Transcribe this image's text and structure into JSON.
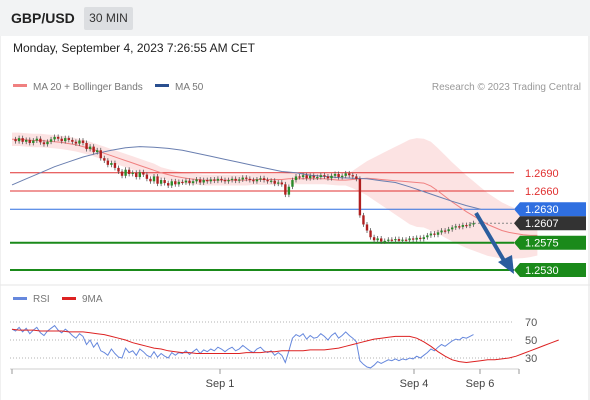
{
  "header": {
    "pair": "GBP/USD",
    "timeframe": "30 MIN"
  },
  "timestamp": "Monday, September 4, 2023 7:26:55 AM CET",
  "legend": {
    "ma20_bb": "MA 20 + Bollinger Bands",
    "ma50": "MA 50",
    "copyright": "Research © 2023 Trading Central"
  },
  "rsi_legend": {
    "rsi": "RSI",
    "ma9": "9MA"
  },
  "colors": {
    "bb": "#f08080",
    "ma50": "#2a4f8f",
    "resistance": "#e03030",
    "support": "#1a8a1a",
    "pivot": "#2f6fe0",
    "price": "#333333",
    "arrow": "#2b5d9e",
    "rsi": "#6688dd",
    "rsi_ma": "#dd2222"
  },
  "chart_data": {
    "type": "line",
    "title": "GBP/USD",
    "ylim": [
      1.2512,
      1.2785
    ],
    "price_levels": [
      {
        "label": "1.2690",
        "value": 1.269,
        "kind": "resistance"
      },
      {
        "label": "1.2660",
        "value": 1.266,
        "kind": "resistance"
      },
      {
        "label": "1.2630",
        "value": 1.263,
        "kind": "pivot"
      },
      {
        "label": "1.2607",
        "value": 1.2607,
        "kind": "last"
      },
      {
        "label": "1.2575",
        "value": 1.2575,
        "kind": "support"
      },
      {
        "label": "1.2530",
        "value": 1.253,
        "kind": "support"
      }
    ],
    "x_ticks": [
      "Sep 1",
      "Sep 4",
      "Sep 6"
    ],
    "close": [
      1.2745,
      1.2742,
      1.2747,
      1.2741,
      1.2744,
      1.2739,
      1.2743,
      1.2746,
      1.274,
      1.2737,
      1.2741,
      1.2745,
      1.2749,
      1.2746,
      1.2742,
      1.2747,
      1.2744,
      1.2741,
      1.2738,
      1.2743,
      1.2739,
      1.2729,
      1.2733,
      1.2724,
      1.2727,
      1.2714,
      1.271,
      1.2703,
      1.2706,
      1.2698,
      1.2692,
      1.2685,
      1.2695,
      1.2688,
      1.269,
      1.2683,
      1.2691,
      1.2687,
      1.268,
      1.2676,
      1.2684,
      1.2672,
      1.2678,
      1.2673,
      1.2669,
      1.2676,
      1.2671,
      1.2675,
      1.2674,
      1.2677,
      1.2673,
      1.2676,
      1.2679,
      1.2674,
      1.2678,
      1.2676,
      1.2679,
      1.2677,
      1.268,
      1.2678,
      1.2676,
      1.2678,
      1.268,
      1.2677,
      1.2679,
      1.2682,
      1.268,
      1.2678,
      1.2676,
      1.2679,
      1.2681,
      1.2678,
      1.2676,
      1.2677,
      1.2672,
      1.2674,
      1.2671,
      1.2654,
      1.2667,
      1.2678,
      1.2684,
      1.2683,
      1.2686,
      1.2681,
      1.2685,
      1.2682,
      1.2683,
      1.2686,
      1.2684,
      1.2681,
      1.2685,
      1.2688,
      1.2683,
      1.2685,
      1.2689,
      1.2686,
      1.2684,
      1.268,
      1.262,
      1.2605,
      1.2595,
      1.2584,
      1.2579,
      1.2582,
      1.2577,
      1.2578,
      1.258,
      1.2579,
      1.2581,
      1.2578,
      1.258,
      1.2579,
      1.2582,
      1.258,
      1.2583,
      1.2581,
      1.2584,
      1.2587,
      1.259,
      1.2588,
      1.2592,
      1.2595,
      1.2594,
      1.2597,
      1.26,
      1.2602,
      1.2601,
      1.2604,
      1.2603,
      1.2605,
      1.2607
    ],
    "ma20": [
      1.2745,
      1.2745,
      1.2744,
      1.2743,
      1.2743,
      1.2742,
      1.2741,
      1.274,
      1.2738,
      1.2736,
      1.2733,
      1.273,
      1.2726,
      1.2722,
      1.2718,
      1.2714,
      1.271,
      1.2706,
      1.2702,
      1.2698,
      1.2694,
      1.269,
      1.2687,
      1.2684,
      1.2682,
      1.268,
      1.2679,
      1.2678,
      1.2678,
      1.2678,
      1.2678,
      1.2678,
      1.2678,
      1.2678,
      1.2679,
      1.2679,
      1.2679,
      1.2679,
      1.2679,
      1.268,
      1.268,
      1.268,
      1.268,
      1.268,
      1.268,
      1.2679,
      1.2678,
      1.2678,
      1.2679,
      1.268,
      1.2681,
      1.268,
      1.2679,
      1.2678,
      1.2677,
      1.2676,
      1.2675,
      1.2674,
      1.2673,
      1.2668,
      1.266,
      1.2651,
      1.2642,
      1.2634,
      1.2626,
      1.2619,
      1.2612,
      1.2605,
      1.26,
      1.2595,
      1.2592,
      1.259,
      1.2588,
      1.2587,
      1.2587
    ],
    "ma20_x": [
      0,
      2,
      4,
      6,
      8,
      10,
      12,
      14,
      16,
      18,
      20,
      22,
      24,
      26,
      28,
      30,
      32,
      34,
      36,
      38,
      40,
      42,
      44,
      46,
      48,
      50,
      52,
      54,
      56,
      58,
      60,
      62,
      64,
      66,
      68,
      70,
      72,
      74,
      76,
      78,
      80,
      82,
      84,
      86,
      88,
      90,
      92,
      94,
      96,
      98,
      100,
      102,
      104,
      106,
      108,
      110,
      112,
      114,
      116,
      118,
      120,
      122,
      124,
      126,
      128,
      130,
      132,
      134,
      136,
      138,
      140,
      142,
      144,
      146,
      148
    ],
    "ma50": [
      1.267,
      1.268,
      1.269,
      1.27,
      1.2708,
      1.2716,
      1.2722,
      1.2727,
      1.2731,
      1.2733,
      1.2732,
      1.273,
      1.2727,
      1.2722,
      1.2717,
      1.2712,
      1.2707,
      1.2702,
      1.2697,
      1.2692,
      1.269,
      1.2686,
      1.2684,
      1.2682,
      1.2681,
      1.268,
      1.2677,
      1.2674,
      1.2667,
      1.2659,
      1.2651,
      1.2643,
      1.2636,
      1.263
    ],
    "ma50_x": [
      0,
      4,
      8,
      12,
      16,
      20,
      24,
      28,
      32,
      36,
      40,
      44,
      48,
      52,
      56,
      60,
      64,
      68,
      72,
      76,
      80,
      84,
      88,
      92,
      96,
      100,
      104,
      108,
      112,
      116,
      120,
      124,
      128,
      132
    ],
    "rsi_ylim": [
      20,
      80
    ],
    "rsi_ticks": [
      70,
      50,
      30
    ],
    "rsi": [
      62,
      60,
      64,
      59,
      63,
      57,
      61,
      64,
      58,
      55,
      60,
      63,
      66,
      61,
      58,
      62,
      59,
      55,
      52,
      57,
      54,
      45,
      50,
      42,
      47,
      38,
      36,
      33,
      40,
      35,
      31,
      30,
      41,
      36,
      38,
      33,
      40,
      37,
      33,
      31,
      37,
      31,
      35,
      32,
      30,
      36,
      33,
      36,
      35,
      38,
      34,
      37,
      40,
      35,
      39,
      37,
      40,
      38,
      42,
      40,
      37,
      40,
      42,
      38,
      40,
      44,
      41,
      38,
      36,
      40,
      42,
      38,
      36,
      38,
      33,
      36,
      33,
      25,
      38,
      52,
      56,
      54,
      57,
      51,
      55,
      52,
      53,
      57,
      54,
      50,
      55,
      58,
      52,
      55,
      59,
      55,
      52,
      48,
      27,
      23,
      20,
      19,
      22,
      26,
      24,
      26,
      28,
      27,
      29,
      27,
      29,
      28,
      30,
      29,
      32,
      30,
      33,
      36,
      40,
      38,
      42,
      45,
      43,
      46,
      49,
      51,
      50,
      53,
      52,
      54,
      56
    ],
    "rsi_ma": [
      62,
      61,
      61,
      61,
      60,
      60,
      60,
      60,
      59,
      59,
      59,
      58,
      57,
      56,
      54,
      52,
      50,
      47,
      45,
      43,
      41,
      40,
      38,
      37,
      36,
      36,
      35,
      35,
      35,
      35,
      35,
      35,
      35,
      36,
      36,
      36,
      37,
      37,
      38,
      38,
      38,
      38,
      39,
      39,
      39,
      40,
      41,
      43,
      45,
      47,
      49,
      51,
      52,
      53,
      54,
      54,
      54,
      52,
      48,
      43,
      37,
      32,
      28,
      26,
      25,
      26,
      27,
      28,
      28,
      29,
      30,
      32,
      35,
      38,
      41,
      44,
      47,
      50
    ],
    "rsi_ma_x": [
      0,
      2,
      4,
      6,
      8,
      10,
      12,
      14,
      16,
      18,
      20,
      22,
      24,
      26,
      28,
      30,
      32,
      34,
      36,
      38,
      40,
      42,
      44,
      46,
      48,
      50,
      52,
      54,
      56,
      58,
      60,
      62,
      64,
      66,
      68,
      70,
      72,
      74,
      76,
      78,
      80,
      82,
      84,
      86,
      88,
      90,
      92,
      94,
      96,
      98,
      100,
      102,
      104,
      106,
      108,
      110,
      112,
      114,
      116,
      118,
      120,
      122,
      124,
      126,
      128,
      130,
      132,
      134,
      136,
      138,
      140,
      142,
      144,
      146,
      148,
      150,
      152,
      154
    ]
  }
}
